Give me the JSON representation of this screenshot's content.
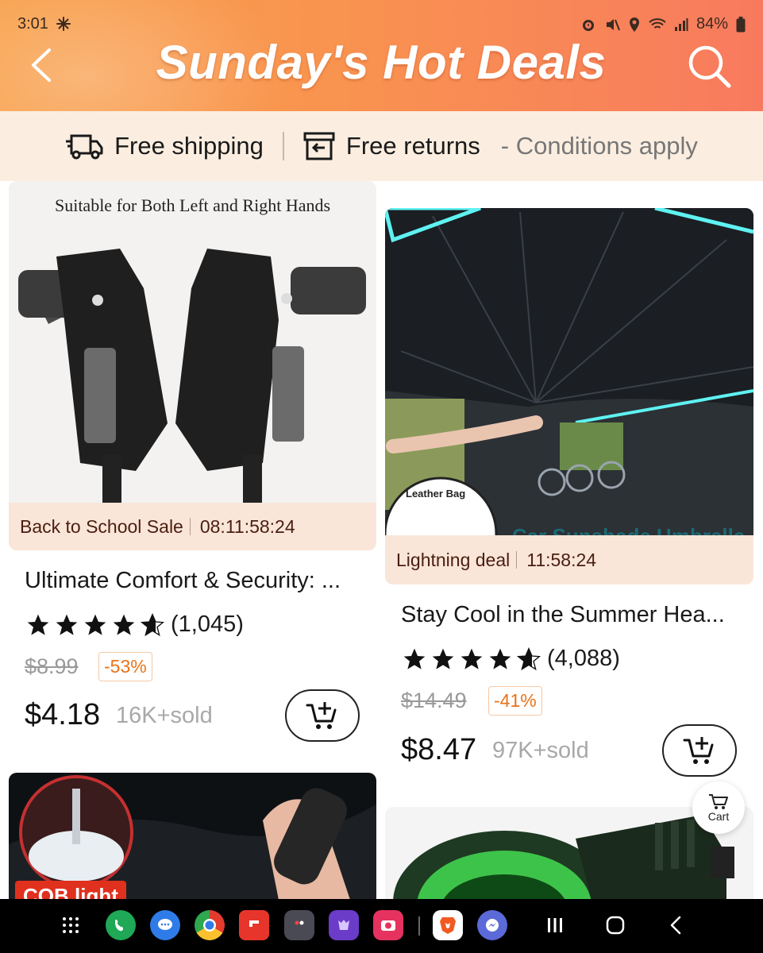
{
  "status_bar": {
    "time": "3:01",
    "battery": "84%"
  },
  "header": {
    "title": "Sunday's Hot Deals"
  },
  "benefits": {
    "shipping": "Free shipping",
    "returns": "Free returns",
    "conditions": "- Conditions apply"
  },
  "products": [
    {
      "image_caption": "Suitable for Both Left and Right Hands",
      "deal_label": "Back to School Sale",
      "deal_timer": "08:11:58:24",
      "title": "Ultimate Comfort & Security: ...",
      "reviews": "(1,045)",
      "original_price": "$8.99",
      "discount": "-53%",
      "price": "$4.18",
      "sold": "16K+sold"
    },
    {
      "image_caption": "Leather Bag",
      "image_banner": "Car Sunshade Umbrella",
      "deal_label": "Lightning deal",
      "deal_timer": "11:58:24",
      "title": "Stay Cool in the Summer Hea...",
      "reviews": "(4,088)",
      "original_price": "$14.49",
      "discount": "-41%",
      "price": "$8.47",
      "sold": "97K+sold"
    },
    {
      "image_badge": "COB light"
    }
  ],
  "floating_cart": {
    "label": "Cart"
  }
}
